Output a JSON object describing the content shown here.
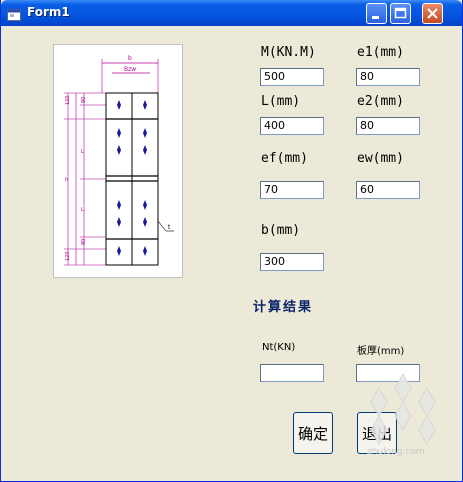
{
  "window": {
    "title": "Form1",
    "icon": "app-icon",
    "controls": [
      "minimize-icon",
      "maximize-icon",
      "close-icon"
    ]
  },
  "drawing": {
    "labels": {
      "b": "b",
      "bw": "Bzw",
      "t": "t",
      "L": "L",
      "h": "h",
      "e_top": "120",
      "e_mid": "80",
      "e_bot": "120",
      "dim80": "80"
    }
  },
  "inputs": {
    "M": {
      "label": "M(KN.M)",
      "value": "500"
    },
    "e1": {
      "label": "e1(mm)",
      "value": "80"
    },
    "L": {
      "label": "L(mm)",
      "value": "400"
    },
    "e2": {
      "label": "e2(mm)",
      "value": "80"
    },
    "ef": {
      "label": "ef(mm)",
      "value": "70"
    },
    "ew": {
      "label": "ew(mm)",
      "value": "60"
    },
    "b": {
      "label": "b(mm)",
      "value": "300"
    }
  },
  "results": {
    "title": "计算结果",
    "nt_label": "Nt(KN)",
    "nt_value": "",
    "thickness_label": "板厚(mm)",
    "thickness_value": ""
  },
  "buttons": {
    "ok": "确定",
    "exit": "退出"
  },
  "watermark": {
    "text": "zhulong.com"
  }
}
